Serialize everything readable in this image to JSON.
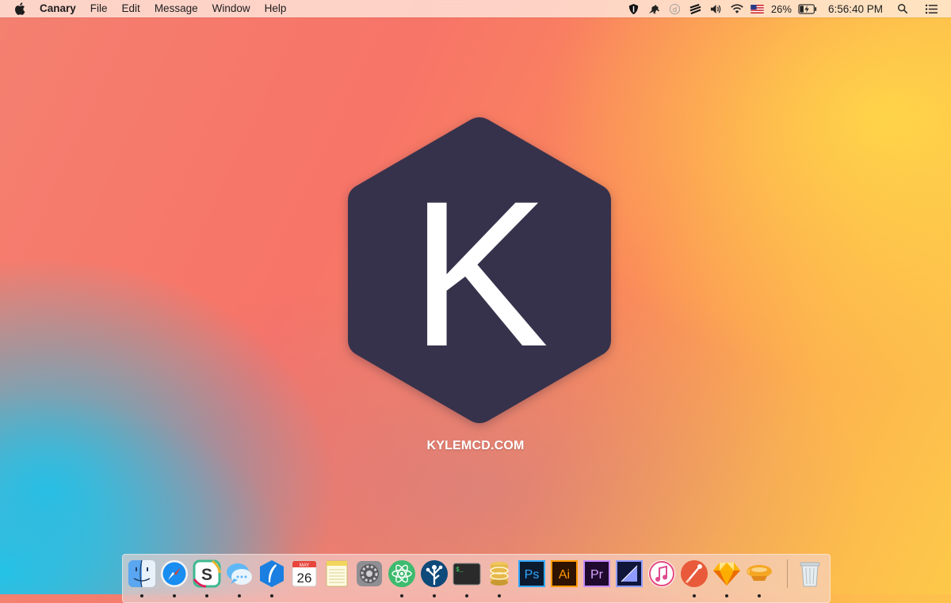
{
  "menubar": {
    "app_name": "Canary",
    "menus": [
      "File",
      "Edit",
      "Message",
      "Window",
      "Help"
    ],
    "battery_percent": "26%",
    "clock": "6:56:40 PM",
    "status_icons": [
      "shield-icon",
      "kangaroo-icon",
      "d-circle-icon",
      "stripes-icon",
      "volume-icon",
      "wifi-icon",
      "us-flag-icon",
      "battery-charging-icon",
      "spotlight-search-icon",
      "notification-center-icon"
    ]
  },
  "logo": {
    "letter": "K",
    "site": "KYLEMCD.COM",
    "hex_color": "#37324b"
  },
  "dock": {
    "apps": [
      {
        "name": "Finder",
        "icon": "finder-icon",
        "running": true
      },
      {
        "name": "Safari",
        "icon": "safari-icon",
        "running": true
      },
      {
        "name": "Slack",
        "icon": "slack-icon",
        "running": true
      },
      {
        "name": "Messages",
        "icon": "messages-icon",
        "running": true
      },
      {
        "name": "Quill",
        "icon": "quill-icon",
        "running": true
      },
      {
        "name": "Calendar",
        "icon": "calendar-icon",
        "running": false,
        "month": "MAY",
        "day": "26"
      },
      {
        "name": "Notes",
        "icon": "notes-icon",
        "running": false
      },
      {
        "name": "System Preferences",
        "icon": "system-preferences-icon",
        "running": false
      },
      {
        "name": "Atom",
        "icon": "atom-icon",
        "running": true
      },
      {
        "name": "SourceTree",
        "icon": "sourcetree-icon",
        "running": true
      },
      {
        "name": "Terminal",
        "icon": "terminal-icon",
        "running": true
      },
      {
        "name": "Sequel Pro",
        "icon": "database-icon",
        "running": true
      },
      {
        "name": "Photoshop",
        "icon": "photoshop-icon",
        "running": false,
        "label": "Ps"
      },
      {
        "name": "Illustrator",
        "icon": "illustrator-icon",
        "running": false,
        "label": "Ai"
      },
      {
        "name": "Premiere",
        "icon": "premiere-icon",
        "running": false,
        "label": "Pr"
      },
      {
        "name": "Media Encoder",
        "icon": "media-encoder-icon",
        "running": false
      },
      {
        "name": "iTunes",
        "icon": "itunes-icon",
        "running": false
      },
      {
        "name": "Paw",
        "icon": "paw-icon",
        "running": true
      },
      {
        "name": "Sketch",
        "icon": "sketch-icon",
        "running": true
      },
      {
        "name": "Airship",
        "icon": "airship-icon",
        "running": true
      },
      {
        "name": "Trash",
        "icon": "trash-icon",
        "running": false
      }
    ]
  }
}
